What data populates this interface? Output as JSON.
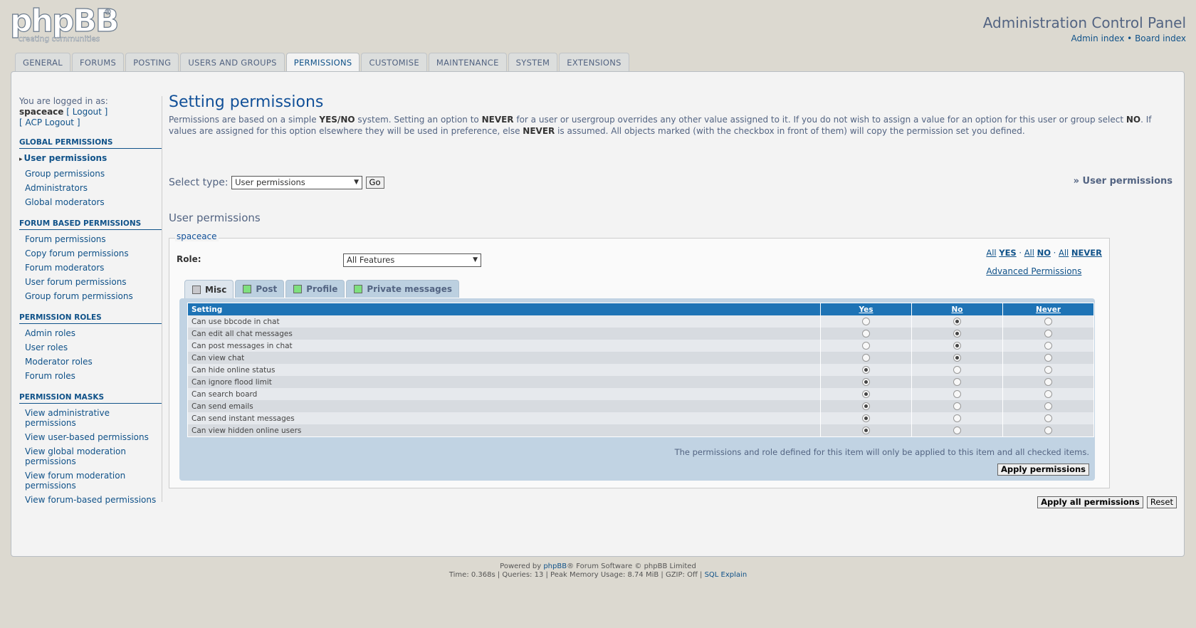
{
  "header": {
    "title": "Administration Control Panel",
    "links": {
      "admin_index": "Admin index",
      "separator": "•",
      "board_index": "Board index"
    },
    "logo_text": "phpBB",
    "logo_sub": "creating communities"
  },
  "tabs": [
    {
      "label": "GENERAL"
    },
    {
      "label": "FORUMS"
    },
    {
      "label": "POSTING"
    },
    {
      "label": "USERS AND GROUPS"
    },
    {
      "label": "PERMISSIONS"
    },
    {
      "label": "CUSTOMISE"
    },
    {
      "label": "MAINTENANCE"
    },
    {
      "label": "SYSTEM"
    },
    {
      "label": "EXTENSIONS"
    }
  ],
  "sidebar": {
    "logged_in_as": "You are logged in as:",
    "username": "spaceace",
    "logout": "[ Logout ]",
    "acp_logout": "[ ACP Logout ]",
    "sections": [
      {
        "heading": "GLOBAL PERMISSIONS",
        "items": [
          "User permissions",
          "Group permissions",
          "Administrators",
          "Global moderators"
        ]
      },
      {
        "heading": "FORUM BASED PERMISSIONS",
        "items": [
          "Forum permissions",
          "Copy forum permissions",
          "Forum moderators",
          "User forum permissions",
          "Group forum permissions"
        ]
      },
      {
        "heading": "PERMISSION ROLES",
        "items": [
          "Admin roles",
          "User roles",
          "Moderator roles",
          "Forum roles"
        ]
      },
      {
        "heading": "PERMISSION MASKS",
        "items": [
          "View administrative permissions",
          "View user-based permissions",
          "View global moderation permissions",
          "View forum moderation permissions",
          "View forum-based permissions"
        ]
      }
    ]
  },
  "content": {
    "title": "Setting permissions",
    "intro_1": "Permissions are based on a simple ",
    "intro_yesno": "YES/NO",
    "intro_2": " system. Setting an option to ",
    "intro_never": "NEVER",
    "intro_3": " for a user or usergroup overrides any other value assigned to it. If you do not wish to assign a value for an option for this user or group select ",
    "intro_no": "NO",
    "intro_4": ". If values are assigned for this option elsewhere they will be used in preference, else ",
    "intro_never2": "NEVER",
    "intro_5": " is assumed. All objects marked (with the checkbox in front of them) will copy the permission set you defined.",
    "select_type_label": "Select type:",
    "select_type_value": "User permissions",
    "go": "Go",
    "breadcrumb": "» User permissions",
    "subtitle": "User permissions",
    "legend": "spaceace",
    "role_label": "Role:",
    "role_value": "All Features",
    "quick": {
      "all": "All",
      "yes": "YES",
      "no": "NO",
      "never": "NEVER",
      "dot": "·",
      "advanced": "Advanced Permissions"
    },
    "perm_tabs": [
      {
        "label": "Misc",
        "color": "grey"
      },
      {
        "label": "Post",
        "color": "green"
      },
      {
        "label": "Profile",
        "color": "green"
      },
      {
        "label": "Private messages",
        "color": "green"
      }
    ],
    "table": {
      "headers": {
        "setting": "Setting",
        "yes": "Yes",
        "no": "No",
        "never": "Never"
      },
      "rows": [
        {
          "label": "Can use bbcode in chat",
          "value": "no"
        },
        {
          "label": "Can edit all chat messages",
          "value": "no"
        },
        {
          "label": "Can post messages in chat",
          "value": "no"
        },
        {
          "label": "Can view chat",
          "value": "no"
        },
        {
          "label": "Can hide online status",
          "value": "yes"
        },
        {
          "label": "Can ignore flood limit",
          "value": "yes"
        },
        {
          "label": "Can search board",
          "value": "yes"
        },
        {
          "label": "Can send emails",
          "value": "yes"
        },
        {
          "label": "Can send instant messages",
          "value": "yes"
        },
        {
          "label": "Can view hidden online users",
          "value": "yes"
        }
      ]
    },
    "note": "The permissions and role defined for this item will only be applied to this item and all checked items.",
    "apply": "Apply permissions",
    "apply_all": "Apply all permissions",
    "reset": "Reset"
  },
  "footer": {
    "powered_pre": "Powered by ",
    "powered_link": "phpBB",
    "powered_post": "® Forum Software © phpBB Limited",
    "stats": "Time: 0.368s | Queries: 13 | Peak Memory Usage: 8.74 MiB | GZIP: Off | ",
    "sql_explain": "SQL Explain"
  }
}
